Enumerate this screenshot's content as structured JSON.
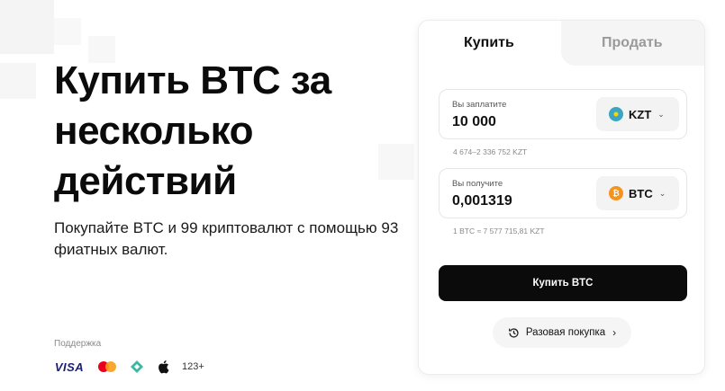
{
  "hero": {
    "title": "Купить BTC за несколько действий",
    "subtitle": "Покупайте BTC и 99 криптовалют с помощью 93 фиатных валют."
  },
  "support": {
    "label": "Поддержка",
    "payment_methods": [
      {
        "name": "VISA",
        "icon": "visa-logo"
      },
      {
        "name": "Mastercard",
        "icon": "mastercard-icon"
      },
      {
        "name": "Crypto",
        "icon": "diamond-icon"
      },
      {
        "name": "Apple Pay",
        "icon": "apple-icon"
      }
    ],
    "more_label": "123+"
  },
  "tabs": {
    "buy": "Купить",
    "sell": "Продать",
    "active": "buy"
  },
  "pay_field": {
    "label": "Вы заплатите",
    "value": "10 000",
    "currency": "KZT",
    "currency_color": "#3aa6c4",
    "range_hint": "4 674–2 336 752 KZT"
  },
  "receive_field": {
    "label": "Вы получите",
    "value": "0,001319",
    "currency": "BTC",
    "currency_color": "#f7931a",
    "rate_hint": "1 BTC ≈ 7 577 715,81 KZT"
  },
  "buy_button": "Купить BTC",
  "one_time_button": "Разовая покупка"
}
